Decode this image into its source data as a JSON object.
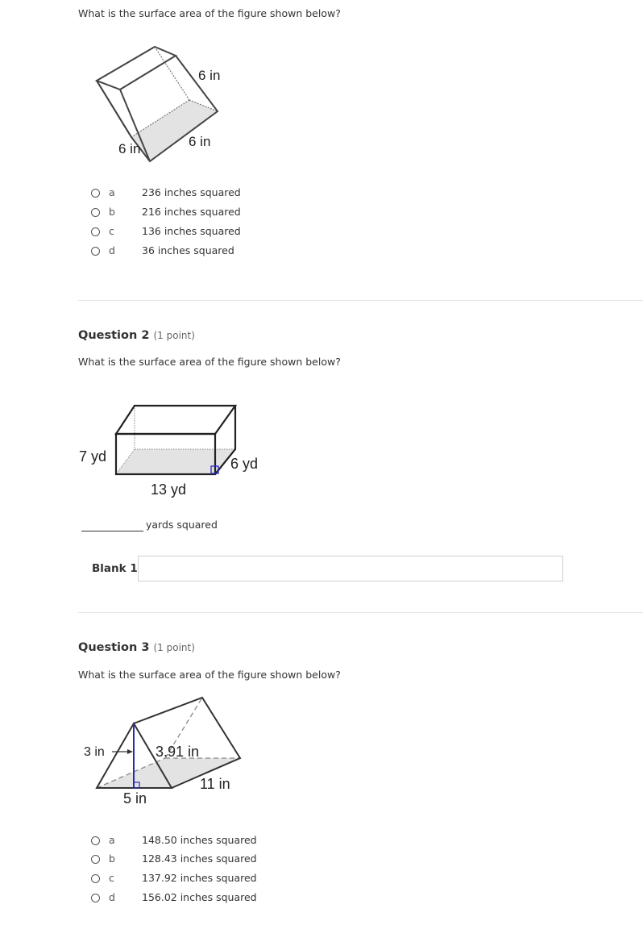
{
  "questions": [
    {
      "title": "",
      "points": "",
      "prompt": "What is the surface area of the figure shown below?",
      "figure": {
        "shape": "cube",
        "labels": [
          "6 in",
          "6 in",
          "6 in"
        ]
      },
      "options": [
        {
          "letter": "a",
          "text": "236 inches squared"
        },
        {
          "letter": "b",
          "text": "216 inches squared"
        },
        {
          "letter": "c",
          "text": "136 inches squared"
        },
        {
          "letter": "d",
          "text": "36 inches squared"
        }
      ]
    },
    {
      "title": "Question 2",
      "points": "(1 point)",
      "prompt": "What is the surface area of the figure shown below?",
      "figure": {
        "shape": "rectangular-prism",
        "labels": {
          "height": "7 yd",
          "length": "13 yd",
          "width": "6 yd"
        }
      },
      "fill_in": {
        "suffix": "yards squared",
        "blank_label": "Blank 1:",
        "value": ""
      }
    },
    {
      "title": "Question 3",
      "points": "(1 point)",
      "prompt": "What is the surface area of the figure shown below?",
      "figure": {
        "shape": "triangular-prism",
        "labels": {
          "height": "3 in",
          "slant": "3.91 in",
          "base": "5 in",
          "length": "11 in"
        }
      },
      "options": [
        {
          "letter": "a",
          "text": "148.50 inches squared"
        },
        {
          "letter": "b",
          "text": "128.43 inches squared"
        },
        {
          "letter": "c",
          "text": "137.92 inches squared"
        },
        {
          "letter": "d",
          "text": "156.02 inches squared"
        }
      ]
    }
  ]
}
